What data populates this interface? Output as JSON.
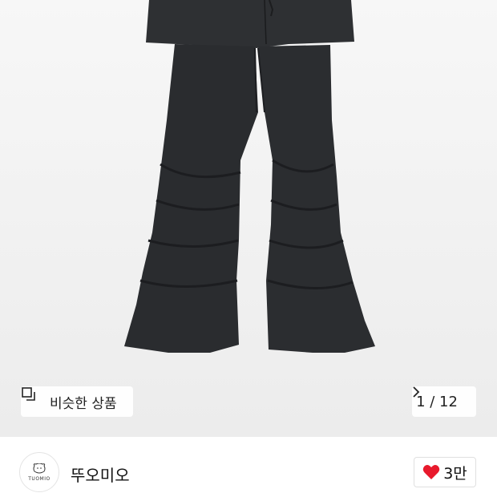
{
  "gallery": {
    "similar_label": "비슷한 상품",
    "counter_label": "1 / 12",
    "similar_icon": "copy-squares-icon",
    "next_icon": "chevron-right-icon"
  },
  "brand": {
    "name": "뚜오미오",
    "logo_text": "TUOMIO"
  },
  "like": {
    "count_label": "3만",
    "icon": "heart-icon",
    "color": "#e8192c"
  }
}
